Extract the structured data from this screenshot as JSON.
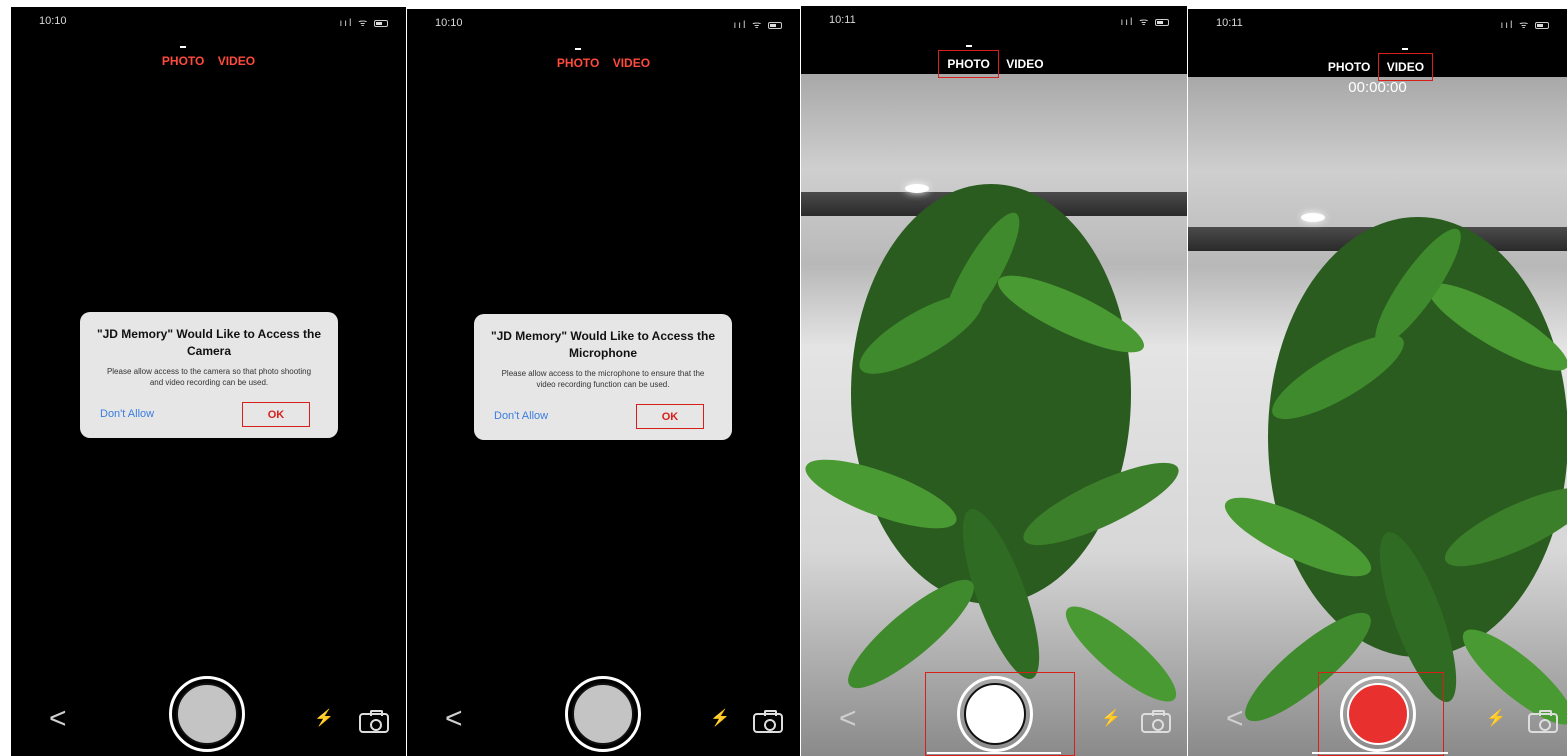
{
  "screens": [
    {
      "time": "10:10",
      "modes": {
        "photo": "PHOTO",
        "video": "VIDEO"
      },
      "alert": {
        "title": "\"JD Memory\" Would Like to Access the Camera",
        "message": "Please allow access to the camera so that photo shooting and video recording can be used.",
        "deny": "Don't Allow",
        "ok": "OK"
      }
    },
    {
      "time": "10:10",
      "modes": {
        "photo": "PHOTO",
        "video": "VIDEO"
      },
      "alert": {
        "title": "\"JD Memory\" Would Like to Access the Microphone",
        "message": "Please allow access to the microphone to ensure that the video recording function can be used.",
        "deny": "Don't Allow",
        "ok": "OK"
      }
    },
    {
      "time": "10:11",
      "modes": {
        "photo": "PHOTO",
        "video": "VIDEO"
      }
    },
    {
      "time": "10:11",
      "modes": {
        "photo": "PHOTO",
        "video": "VIDEO"
      },
      "timer": "00:00:00"
    }
  ],
  "icons": {
    "back": "chevron-left-icon",
    "flash": "flash-icon",
    "flip": "camera-flip-icon"
  },
  "colors": {
    "accent": "#ff4a3d",
    "highlight": "#d8201b",
    "record": "#e8312f",
    "link": "#3a7de0"
  }
}
